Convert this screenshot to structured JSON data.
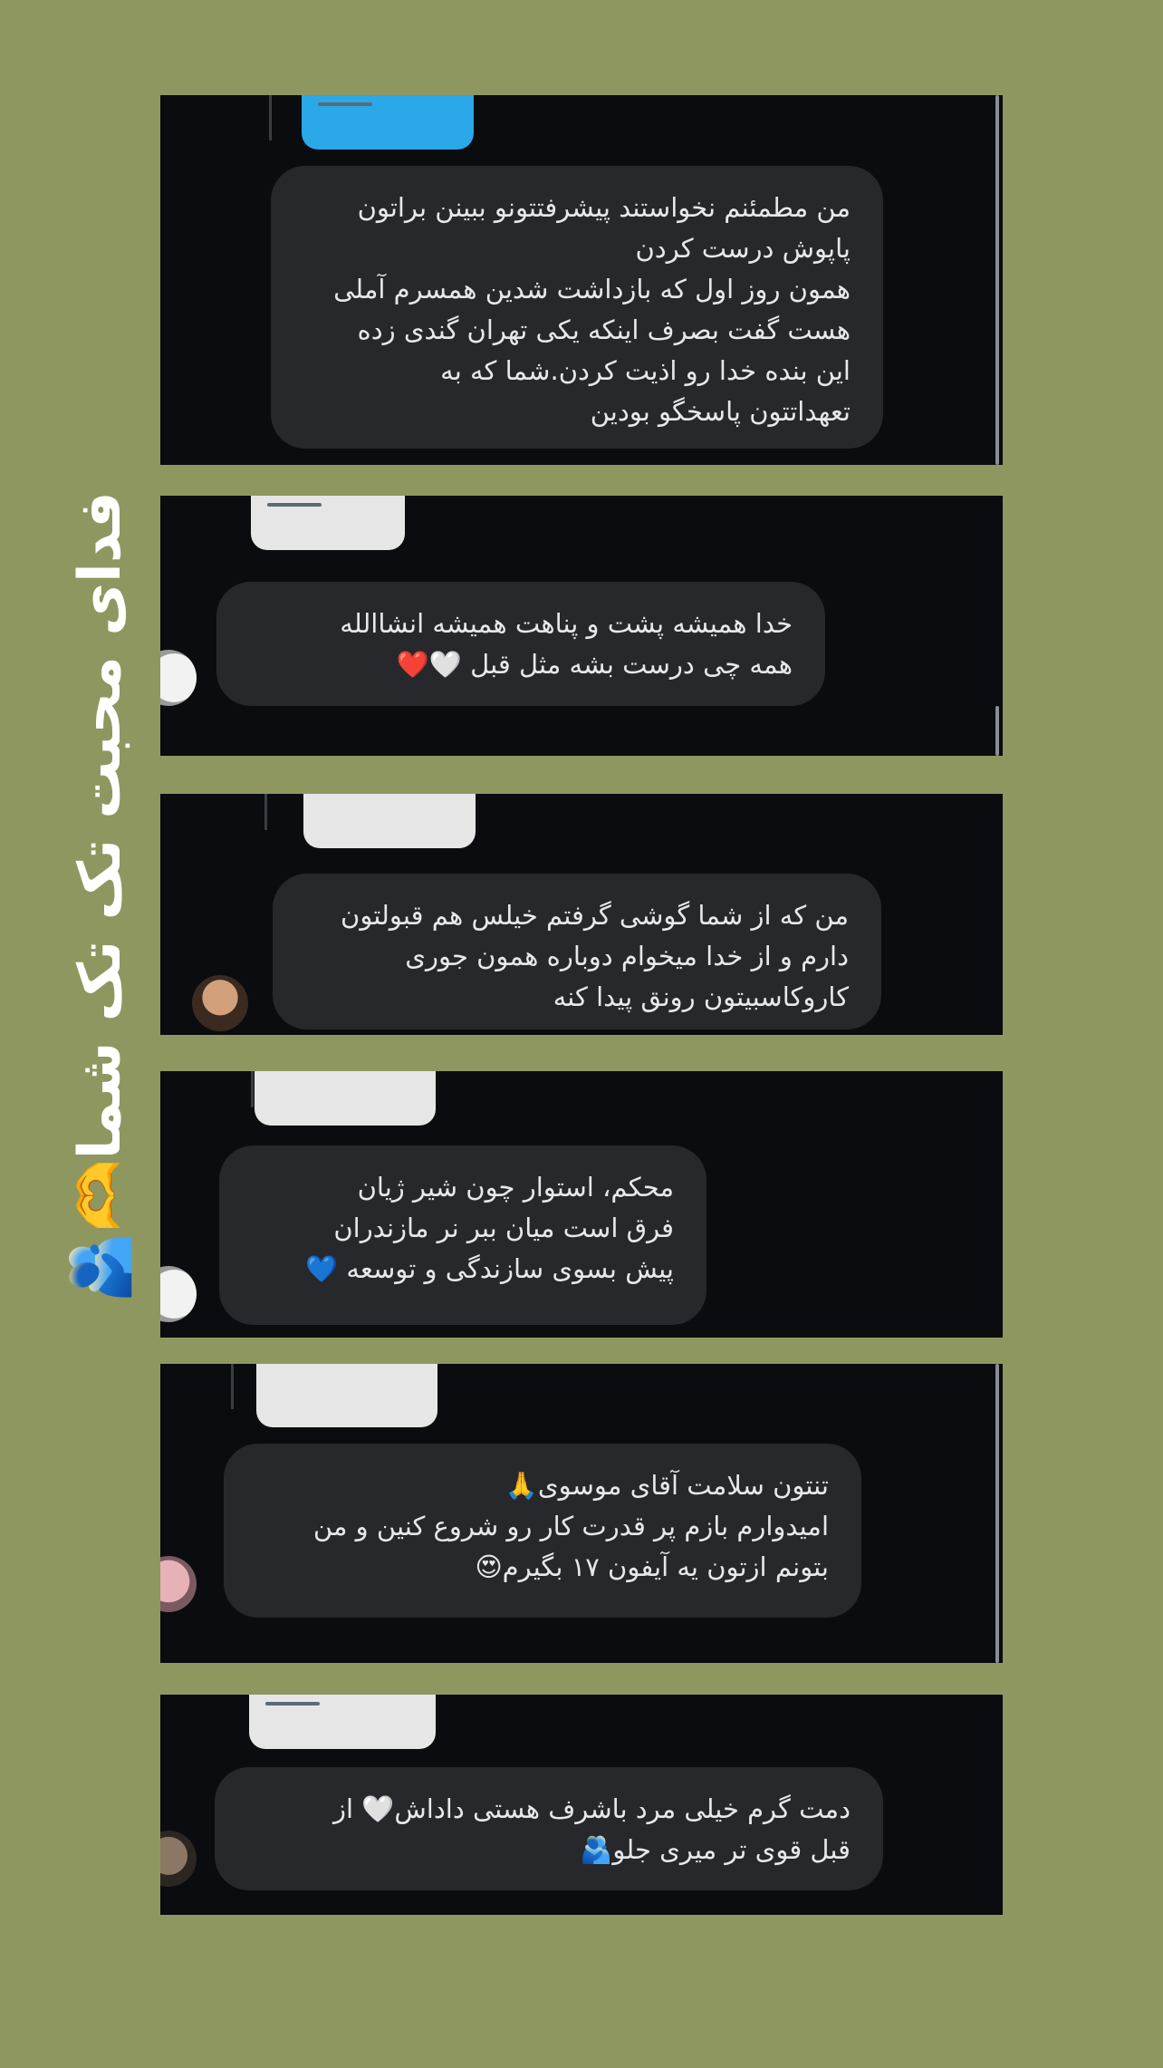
{
  "side_caption": "فدای محبت تک تک شما🫶🫂",
  "comments": [
    {
      "text": "من مطمئنم نخواستند پیشرفتتونو ببینن براتون\nپاپوش درست کردن\nهمون روز اول که بازداشت شدین همسرم آملی\nهست گفت بصرف اینکه یکی تهران گندی زده\nاین بنده خدا رو اذیت کردن.شما که به\nتعهداتتون پاسخگو بودین"
    },
    {
      "text": "خدا همیشه پشت و پناهت همیشه انشاالله\nهمه چی درست بشه مثل قبل 🤍❤️"
    },
    {
      "text": "من که از شما گوشی گرفتم خیلس هم قبولتون\nدارم و از خدا میخوام دوباره همون جوری\nکاروکاسبیتون رونق پیدا کنه"
    },
    {
      "text": "محکم، استوار چون شیر ژیان\nفرق است میان ببر نر مازندران\nپیش بسوی سازندگی و توسعه 💙"
    },
    {
      "text": "تنتون سلامت آقای موسوی🙏\nامیدوارم بازم پر قدرت کار رو شروع کنین و من\nبتونم ازتون یه آیفون ۱۷ بگیرم😍"
    },
    {
      "text": "دمت گرم خیلی مرد باشرف هستی داداش🤍 از\nقبل قوی تر میری جلو🫂"
    }
  ]
}
